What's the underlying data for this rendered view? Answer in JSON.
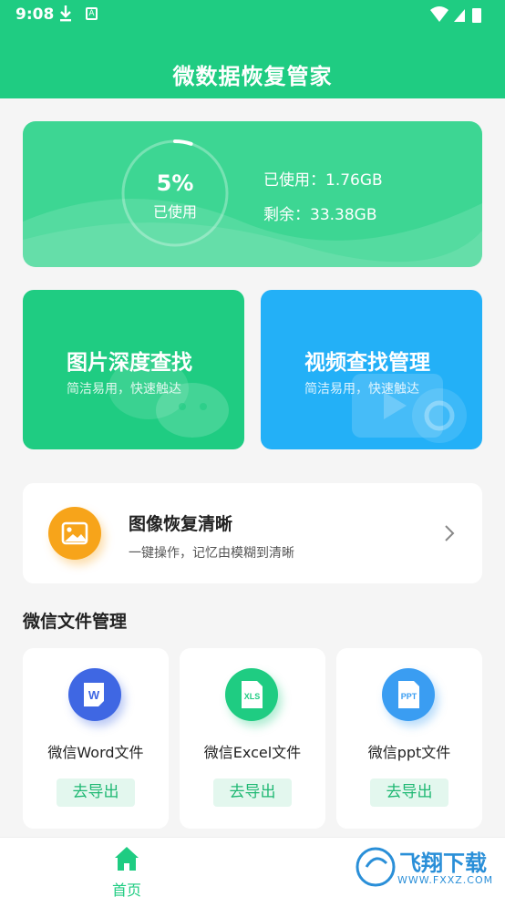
{
  "status_bar": {
    "time": "9:08"
  },
  "header": {
    "title": "微数据恢复管家"
  },
  "storage": {
    "used_fraction": 0.05,
    "percent_text": "5%",
    "percent_label": "已使用",
    "used_text": "已使用：1.76GB",
    "remain_text": "剩余：33.38GB"
  },
  "features": [
    {
      "title": "图片深度查找",
      "subtitle": "简洁易用，快速触达",
      "color": "#1fcc82"
    },
    {
      "title": "视频查找管理",
      "subtitle": "简洁易用，快速触达",
      "color": "#23b0f7"
    }
  ],
  "restore": {
    "title": "图像恢复清晰",
    "subtitle": "一键操作，记忆由模糊到清晰",
    "icon": "image-icon"
  },
  "wechat_section": {
    "title": "微信文件管理",
    "files": [
      {
        "icon_text": "W",
        "label": "微信Word文件",
        "button": "去导出",
        "color": "#3f67e3"
      },
      {
        "icon_text": "XLS",
        "label": "微信Excel文件",
        "button": "去导出",
        "color": "#1fcc82"
      },
      {
        "icon_text": "PPT",
        "label": "微信ppt文件",
        "button": "去导出",
        "color": "#3a9df2"
      }
    ]
  },
  "bottom_nav": {
    "home_label": "首页"
  },
  "watermark": {
    "text": "飞翔下载",
    "url": "WWW.FXXZ.COM"
  },
  "colors": {
    "brand": "#1fcc82",
    "video": "#23b0f7",
    "restore": "#f7a41a"
  }
}
